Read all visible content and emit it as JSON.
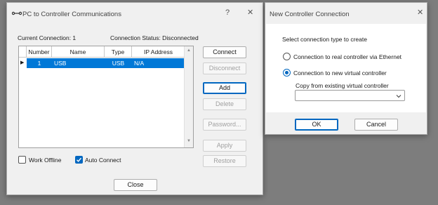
{
  "pc_window": {
    "title": "PC to Controller Communications",
    "help_glyph": "?",
    "close_glyph": "✕",
    "current_connection_label": "Current Connection: 1",
    "connection_status_label": "Connection Status: Disconnected",
    "table": {
      "columns": [
        "Number",
        "Name",
        "Type",
        "IP Address"
      ],
      "rows": [
        {
          "marker": "▶",
          "number": "1",
          "name": "USB",
          "type": "USB",
          "ip": "N/A"
        }
      ]
    },
    "buttons": {
      "connect": "Connect",
      "disconnect": "Disconnect",
      "add": "Add",
      "delete": "Delete",
      "password": "Password...",
      "apply": "Apply",
      "restore": "Restore",
      "close": "Close"
    },
    "work_offline": {
      "label": "Work Offline",
      "checked": false
    },
    "auto_connect": {
      "label": "Auto Connect",
      "checked": true
    }
  },
  "ncc_window": {
    "title": "New Controller Connection",
    "close_glyph": "✕",
    "prompt": "Select connection type to create",
    "option_real": "Connection to real controller via Ethernet",
    "option_virtual": "Connection to new virtual controller",
    "selected_option": "virtual",
    "copy_label": "Copy from existing virtual controller",
    "copy_value": "",
    "ok": "OK",
    "cancel": "Cancel"
  },
  "icons": [
    "connection-icon",
    "help-icon",
    "close-icon",
    "row-marker-icon",
    "chevron-down-icon",
    "scroll-up-icon",
    "scroll-down-icon",
    "checkmark-icon"
  ],
  "colors": {
    "accent": "#0067c0",
    "selection": "#0078d7"
  }
}
